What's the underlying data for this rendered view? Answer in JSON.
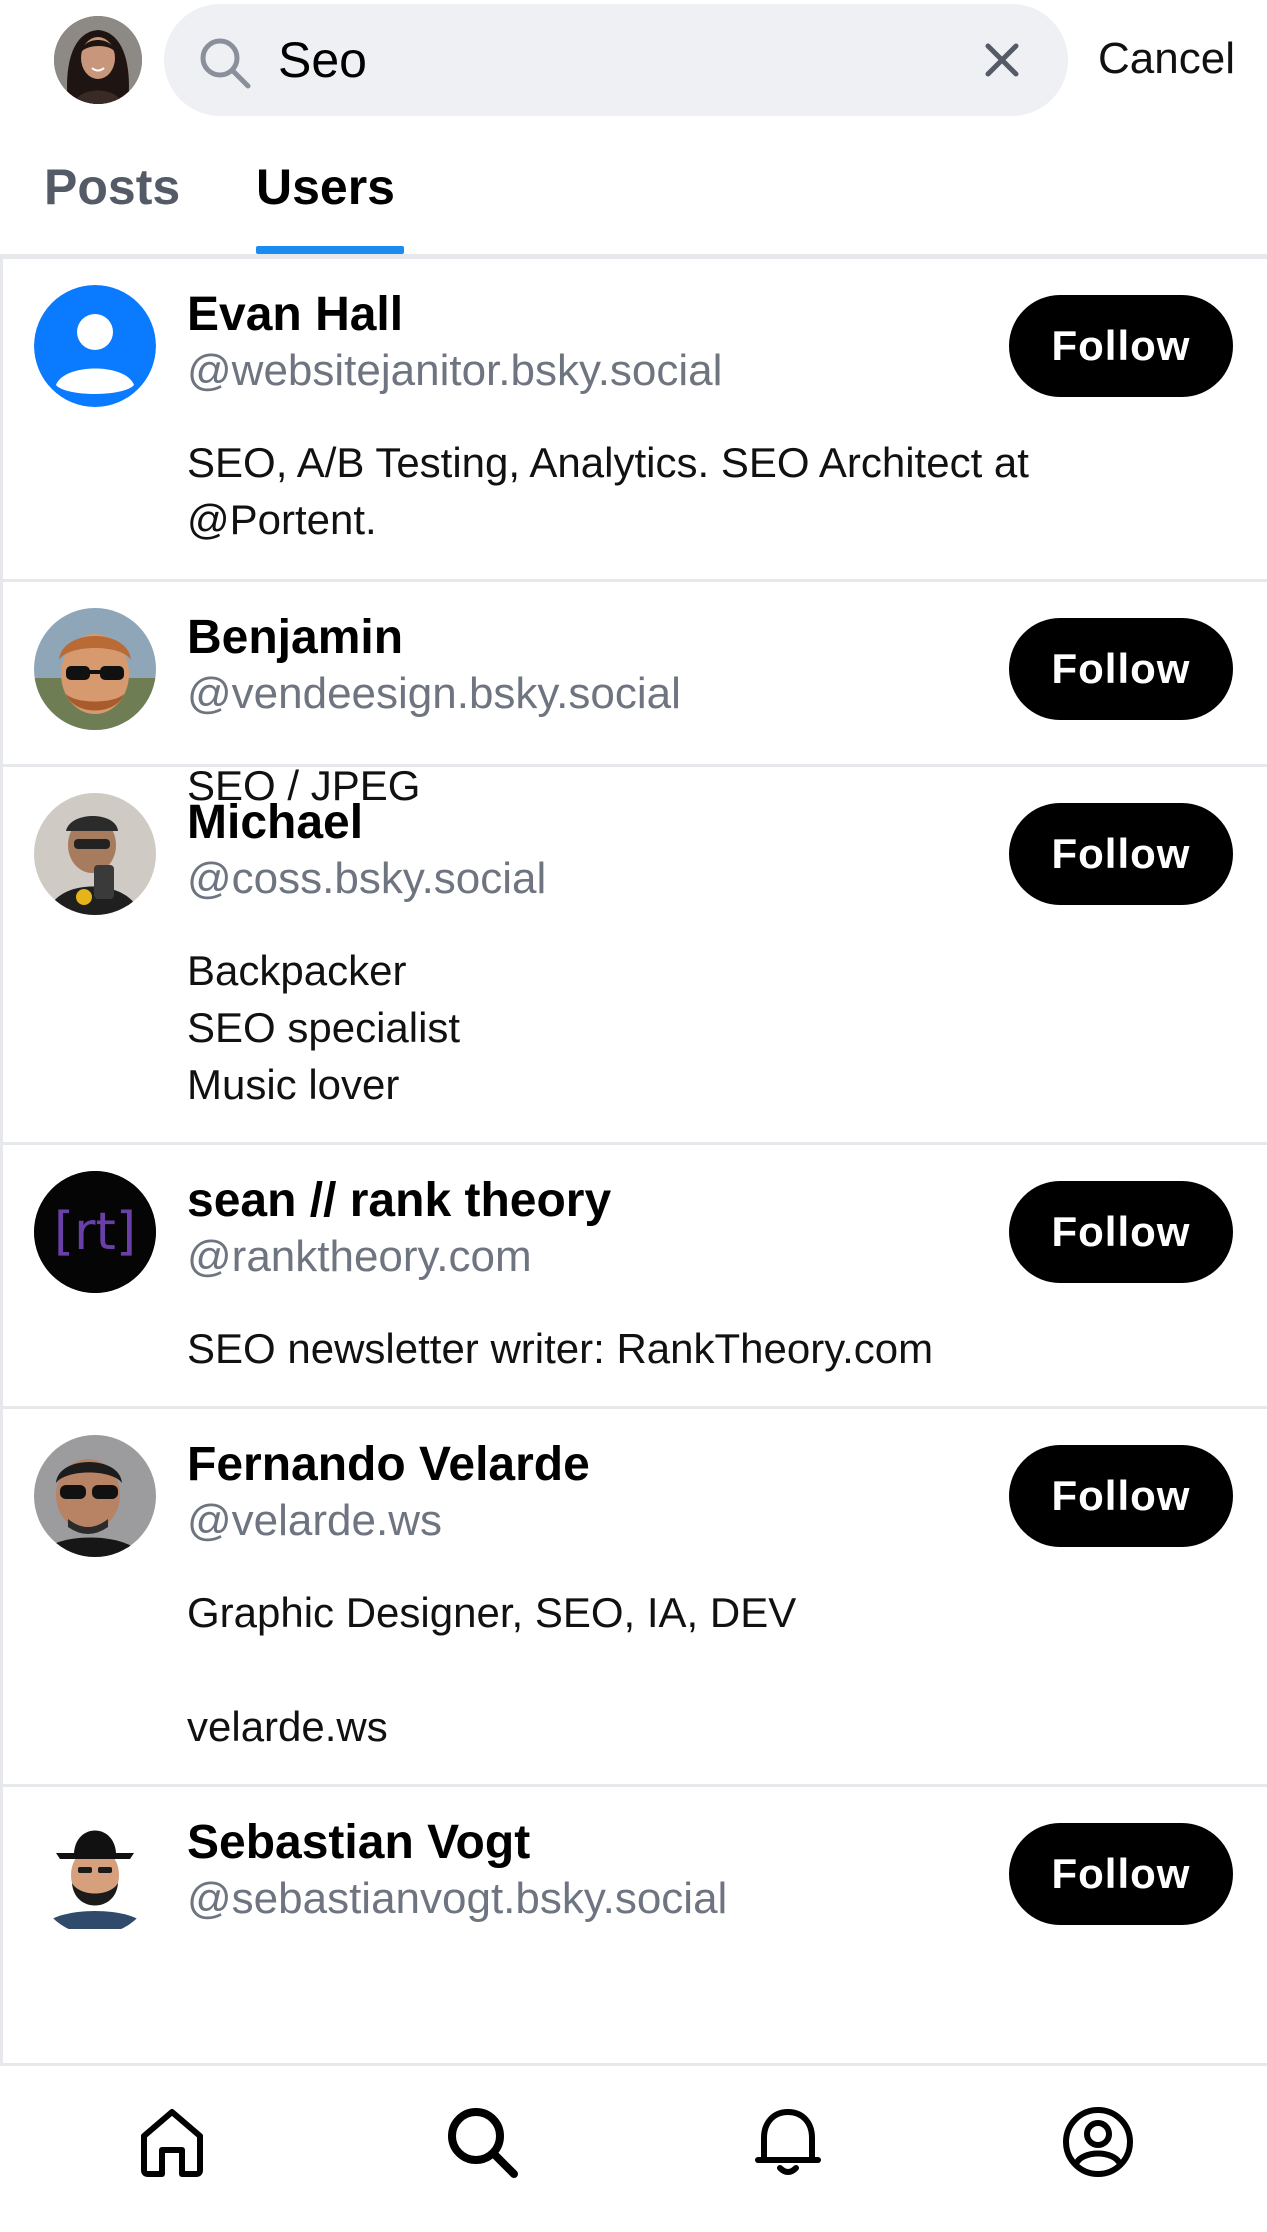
{
  "header": {
    "avatar_icon": "profile-photo",
    "search": {
      "value": "Seo",
      "placeholder": "Search",
      "icon": "search-icon",
      "clear_icon": "close-icon"
    },
    "cancel_label": "Cancel"
  },
  "tabs": [
    {
      "label": "Posts",
      "active": false
    },
    {
      "label": "Users",
      "active": true
    }
  ],
  "colors": {
    "accent": "#1a8cf0",
    "follow_button_bg": "#000000",
    "handle_text": "#6e7480",
    "divider": "#e6e8ec",
    "search_bg": "#eef0f3"
  },
  "users": [
    {
      "name": "Evan Hall",
      "handle": "@websitejanitor.bsky.social",
      "bio": "SEO, A/B Testing, Analytics. SEO Architect at\n@Portent.",
      "follow_label": "Follow",
      "avatar": "default-avatar-icon"
    },
    {
      "name": "Benjamin",
      "handle": "@vendeesign.bsky.social",
      "bio": "SEO / JPEG",
      "follow_label": "Follow",
      "avatar": "profile-photo"
    },
    {
      "name": "Michael",
      "handle": "@coss.bsky.social",
      "bio": "Backpacker\nSEO specialist\nMusic lover",
      "follow_label": "Follow",
      "avatar": "profile-photo"
    },
    {
      "name": "sean // rank theory",
      "handle": "@ranktheory.com",
      "bio": "SEO newsletter writer: RankTheory.com",
      "follow_label": "Follow",
      "avatar": "logo",
      "avatar_text": "[rt]"
    },
    {
      "name": "Fernando Velarde",
      "handle": "@velarde.ws",
      "bio": "Graphic Designer, SEO, IA, DEV\n\nvelarde.ws",
      "follow_label": "Follow",
      "avatar": "profile-photo"
    },
    {
      "name": "Sebastian Vogt",
      "handle": "@sebastianvogt.bsky.social",
      "bio": "",
      "follow_label": "Follow",
      "avatar": "cartoon-avatar"
    }
  ],
  "bottom_nav": [
    {
      "icon": "home-icon"
    },
    {
      "icon": "search-icon",
      "active": true
    },
    {
      "icon": "bell-icon"
    },
    {
      "icon": "profile-icon"
    }
  ]
}
